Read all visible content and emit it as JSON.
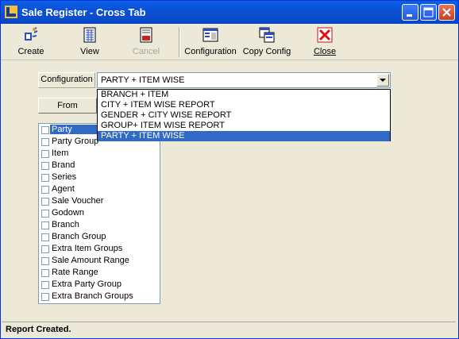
{
  "window": {
    "title": "Sale Register - Cross Tab"
  },
  "toolbar": [
    {
      "label": "Create",
      "icon": "create-report-icon",
      "enabled": true
    },
    {
      "label": "View",
      "icon": "view-grid-icon",
      "enabled": true
    },
    {
      "label": "Cancel",
      "icon": "stop-icon",
      "enabled": false
    },
    {
      "label": "Configuration",
      "icon": "configuration-window-icon",
      "enabled": true
    },
    {
      "label": "Copy Config",
      "icon": "copy-config-icon",
      "enabled": true
    },
    {
      "label": "Close",
      "icon": "close-x-icon",
      "enabled": true
    }
  ],
  "configuration": {
    "label": "Configuration",
    "value": "PARTY + ITEM WISE",
    "options": [
      "BRANCH + ITEM",
      "CITY + ITEM WISE REPORT",
      "GENDER + CITY WISE REPORT",
      "GROUP+ ITEM WISE REPORT",
      "PARTY + ITEM WISE"
    ],
    "selected_index": 4
  },
  "from_button": {
    "label": "From"
  },
  "fields": [
    {
      "label": "Party",
      "checked": false,
      "selected": true
    },
    {
      "label": "Party Group",
      "checked": false
    },
    {
      "label": "Item",
      "checked": false
    },
    {
      "label": "Brand",
      "checked": false
    },
    {
      "label": "Series",
      "checked": false
    },
    {
      "label": "Agent",
      "checked": false
    },
    {
      "label": "Sale Voucher",
      "checked": false
    },
    {
      "label": "Godown",
      "checked": false
    },
    {
      "label": "Branch",
      "checked": false
    },
    {
      "label": "Branch Group",
      "checked": false
    },
    {
      "label": "Extra Item Groups",
      "checked": false
    },
    {
      "label": "Sale Amount Range",
      "checked": false
    },
    {
      "label": "Rate Range",
      "checked": false
    },
    {
      "label": "Extra Party Group",
      "checked": false
    },
    {
      "label": "Extra Branch Groups",
      "checked": false
    }
  ],
  "status": {
    "text": "Report Created."
  },
  "colors": {
    "titlebar": "#0a5fe6",
    "selection": "#316ac5",
    "face": "#ece9d8"
  }
}
